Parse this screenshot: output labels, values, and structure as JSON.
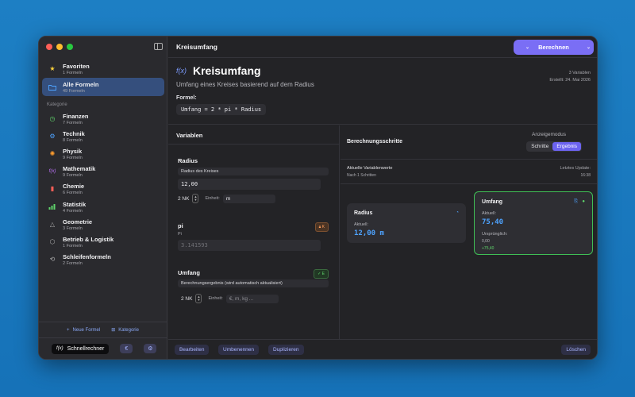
{
  "window": {
    "title": "Kreisumfang"
  },
  "toolbar": {
    "calculate_label": "Berechnen"
  },
  "sidebar": {
    "favorites": {
      "label": "Favoriten",
      "count": "1 Formeln"
    },
    "all": {
      "label": "Alle Formeln",
      "count": "49 Formeln"
    },
    "category_header": "Kategorie",
    "categories": [
      {
        "label": "Finanzen",
        "count": "7 Formeln",
        "icon": "clock-icon",
        "color": "#5fd46b"
      },
      {
        "label": "Technik",
        "count": "8 Formeln",
        "icon": "gear-icon",
        "color": "#4ea3ff"
      },
      {
        "label": "Physik",
        "count": "9 Formeln",
        "icon": "atom-icon",
        "color": "#ff9d2e"
      },
      {
        "label": "Mathematik",
        "count": "9 Formeln",
        "icon": "function-icon",
        "color": "#c074ff"
      },
      {
        "label": "Chemie",
        "count": "6 Formeln",
        "icon": "flask-icon",
        "color": "#ff5f57"
      },
      {
        "label": "Statistik",
        "count": "4 Formeln",
        "icon": "chart-icon",
        "color": "#5fd46b"
      },
      {
        "label": "Geometrie",
        "count": "3 Formeln",
        "icon": "triangle-icon",
        "color": "#aaaaaa"
      },
      {
        "label": "Betrieb & Logistik",
        "count": "1 Formeln",
        "icon": "box-icon",
        "color": "#aaaaaa"
      },
      {
        "label": "Schleifenformeln",
        "count": "2 Formeln",
        "icon": "loop-icon",
        "color": "#aaaaaa"
      }
    ],
    "new_formula": "Neue Formel",
    "category_button": "Kategorie",
    "quick_calc": "Schnellrechner",
    "quick_calc_prefix": "f(x)"
  },
  "formula": {
    "fx": "f(x)",
    "title": "Kreisumfang",
    "description": "Umfang eines Kreises basierend auf dem Radius",
    "formula_label": "Formel:",
    "expression": "Umfang = 2 * pi * Radius",
    "var_count": "3 Variablen",
    "created": "Erstellt: 24. Mai 2026"
  },
  "variables": {
    "header": "Variablen",
    "radius": {
      "name": "Radius",
      "desc": "Radius des Kreises",
      "value": "12,00",
      "decimals": "2 NK",
      "unit_label": "Einheit:",
      "unit": "m"
    },
    "pi": {
      "name": "pi",
      "badge": "K",
      "sub": "Pi",
      "value": "3.141593"
    },
    "umfang": {
      "name": "Umfang",
      "badge": "E",
      "desc": "Berechnungsergebnis (wird automatisch aktualisiert)",
      "decimals": "2 NK",
      "unit_label": "Einheit:",
      "unit_placeholder": "€, m, kg ..."
    }
  },
  "steps": {
    "header": "Berechnungsschritte",
    "mode_label": "Anzeigemodus",
    "mode_steps": "Schritte",
    "mode_result": "Ergebnis",
    "current_title": "Aktuelle Variablenwerte",
    "current_sub": "Nach 1 Schritten",
    "last_update_label": "Letztes Update:",
    "last_update_time": "16:38",
    "radius_card": {
      "title": "Radius",
      "current_label": "Aktuell:",
      "value": "12,00 m"
    },
    "umfang_card": {
      "title": "Umfang",
      "current_label": "Aktuell:",
      "value": "75,40",
      "original_label": "Ursprünglich:",
      "original_value": "0,00",
      "delta": "+75,40"
    }
  },
  "bottom": {
    "edit": "Bearbeiten",
    "rename": "Umbenennen",
    "duplicate": "Duplizieren",
    "delete": "Löschen"
  },
  "colors": {
    "accent": "#7a6ef5",
    "value_blue": "#4ea3ff",
    "success": "#5fd46b",
    "warning": "#ff9d5c"
  }
}
